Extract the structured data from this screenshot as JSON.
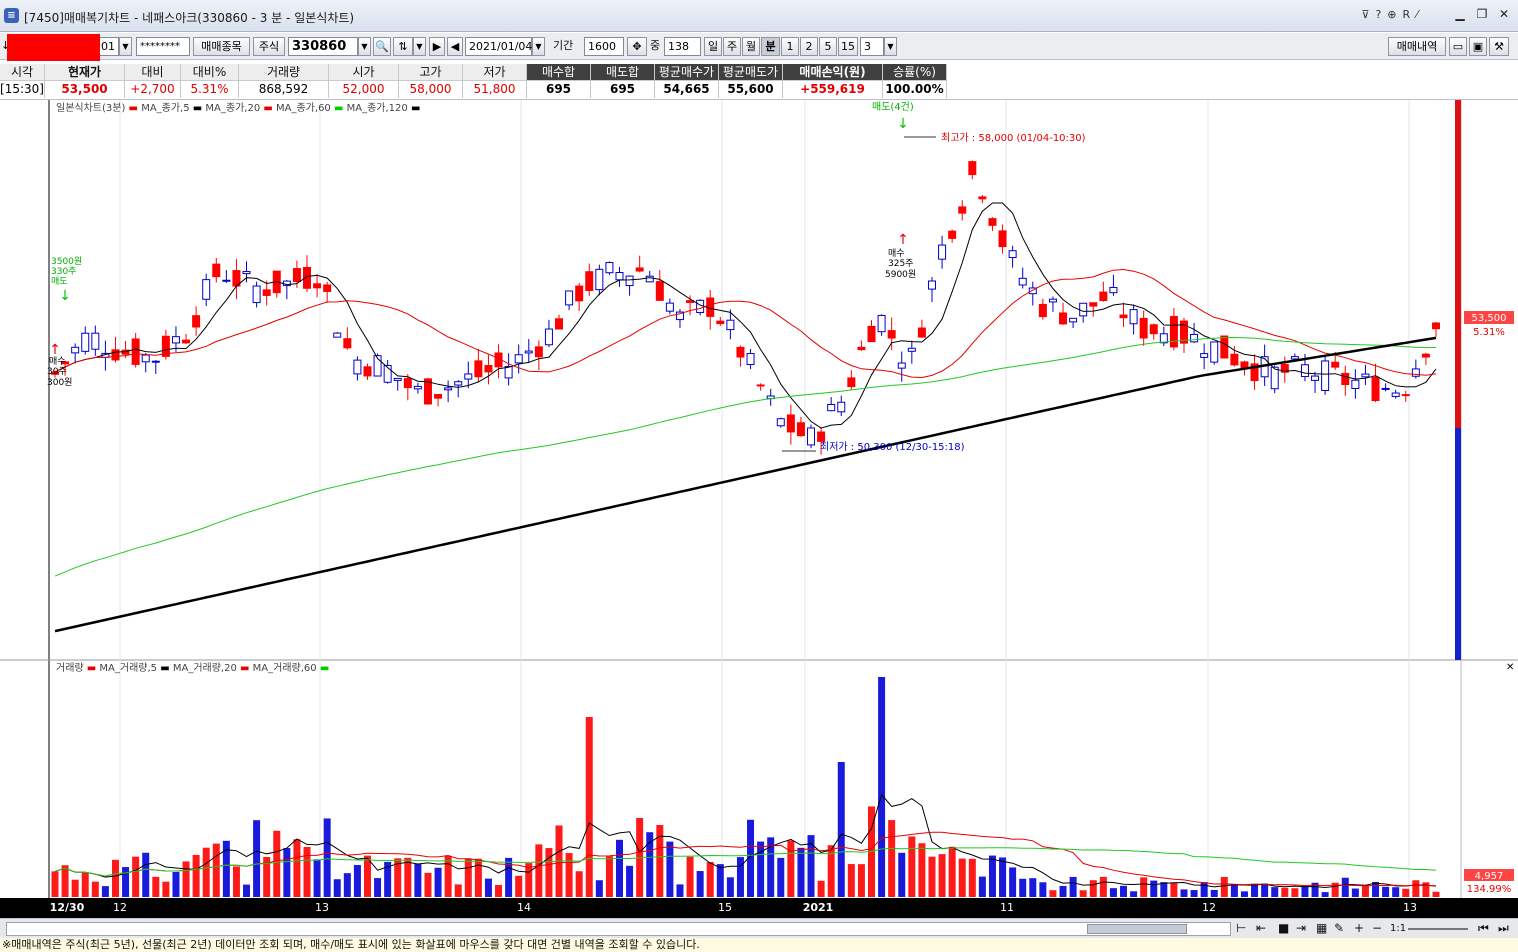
{
  "window": {
    "title": "[7450]매매복기차트 - 네패스아크(330860 - 3 분 - 일본식차트)",
    "header_icons": [
      "?",
      "⊕",
      "R",
      "⁄"
    ],
    "minimize": "▁",
    "restore": "❐",
    "close": "✕"
  },
  "toolbar": {
    "account_suffix": "01",
    "password": "********",
    "trade_item_button": "매매종목",
    "market_label": "주식",
    "code": "330860",
    "date": "2021/01/04",
    "period_label": "기간",
    "period_value": "1600",
    "middle_label": "중",
    "count_value": "138",
    "timeframes": [
      "일",
      "주",
      "월",
      "분",
      "1",
      "2",
      "5",
      "15"
    ],
    "active_timeframe": "분",
    "interval_value": "3",
    "trade_history_button": "매매내역"
  },
  "info_table": {
    "headers": [
      "시각",
      "현재가",
      "대비",
      "대비%",
      "거래량",
      "시가",
      "고가",
      "저가",
      "매수합",
      "매도합",
      "평균매수가",
      "평균매도가",
      "매매손익(원)",
      "승률(%)"
    ],
    "values": [
      "[15:30]",
      "53,500",
      "+2,700",
      "5.31%",
      "868,592",
      "52,000",
      "58,000",
      "51,800",
      "695",
      "695",
      "54,665",
      "55,600",
      "+559,619",
      "100.00%"
    ]
  },
  "chart_data": [
    {
      "type": "candlestick",
      "legend": [
        "일본식차트(3분)",
        "MA_종가,5",
        "MA_종가,20",
        "MA_종가,60",
        "MA_종가,120"
      ],
      "legend_colors": [
        "#e60000",
        "#000000",
        "#e60000",
        "#00cc00",
        "#000000"
      ],
      "ohlc_sample": [
        {
          "o": 52.2,
          "h": 52.4,
          "l": 51.8,
          "c": 52.0
        },
        {
          "o": 52.0,
          "h": 52.8,
          "l": 51.9,
          "c": 52.6
        },
        {
          "o": 52.6,
          "h": 53.6,
          "l": 52.5,
          "c": 53.4
        },
        {
          "o": 53.3,
          "h": 53.6,
          "l": 52.9,
          "c": 53.0
        },
        {
          "o": 53.0,
          "h": 53.2,
          "l": 52.6,
          "c": 52.8
        }
      ],
      "high_annotation": "최고가 : 58,000 (01/04-10:30)",
      "low_annotation": "최저가 : 50,300 (12/30-15:18)",
      "sell_marker": "매도(4건)",
      "buy_marker_left": [
        "3500원",
        "330주",
        "매도"
      ],
      "buy_marker_left_bottom": [
        "매수",
        "30주",
        "300원"
      ],
      "buy_marker_mid": [
        "매수",
        "325주",
        "5900원"
      ],
      "price_tag": "53,500",
      "price_change_tag": "5.31%"
    },
    {
      "type": "bar",
      "legend": [
        "거래량",
        "MA_거래량,5",
        "MA_거래량,20",
        "MA_거래량,60"
      ],
      "legend_colors": [
        "#000000",
        "#e60000",
        "#000000",
        "#e60000",
        "#00cc00"
      ],
      "volume_tag": "4,957",
      "volume_pct_tag": "134.99%"
    }
  ],
  "date_axis": {
    "labels": [
      "12/30",
      "12",
      "13",
      "14",
      "15",
      "2021",
      "11",
      "12",
      "13"
    ]
  },
  "nav": {
    "zoom": "1:1"
  },
  "status": {
    "message": "※매매내역은 주식(최근 5년), 선물(최근 2년) 데이터만 조회 되며, 매수/매도 표시에 있는 화살표에 마우스를 갖다 대면 건별 내역을 조회할 수 있습니다."
  }
}
